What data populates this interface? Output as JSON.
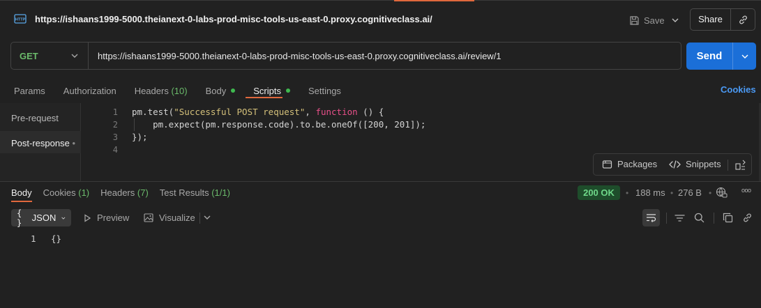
{
  "request": {
    "title": "https://ishaans1999-5000.theianext-0-labs-prod-misc-tools-us-east-0.proxy.cognitiveclass.ai/",
    "method": "GET",
    "url": "https://ishaans1999-5000.theianext-0-labs-prod-misc-tools-us-east-0.proxy.cognitiveclass.ai/review/1"
  },
  "toolbar": {
    "save_label": "Save",
    "share_label": "Share",
    "send_label": "Send"
  },
  "request_tabs": {
    "params": "Params",
    "authorization": "Authorization",
    "headers": "Headers",
    "headers_count": "(10)",
    "body": "Body",
    "scripts": "Scripts",
    "settings": "Settings",
    "cookies": "Cookies"
  },
  "scripts_panel": {
    "pre_request": "Pre-request",
    "post_response": "Post-response",
    "post_response_marker": "•",
    "line_numbers": [
      "1",
      "2",
      "3",
      "4"
    ],
    "code": {
      "l1_a": "pm.test(",
      "l1_str": "\"Successful POST request\"",
      "l1_b": ", ",
      "l1_kw": "function",
      "l1_c": " () {",
      "l2": "    pm.expect(pm.response.code).to.be.oneOf([200, 201]);",
      "l3": "});"
    },
    "packages_label": "Packages",
    "snippets_label": "Snippets"
  },
  "response": {
    "tabs": {
      "body": "Body",
      "cookies": "Cookies",
      "cookies_count": "(1)",
      "headers": "Headers",
      "headers_count": "(7)",
      "tests": "Test Results",
      "tests_count": "(1/1)"
    },
    "status": "200 OK",
    "time": "188 ms",
    "size": "276 B",
    "separator": "•",
    "more": "ooo",
    "format": "JSON",
    "format_prefix": "{ }",
    "preview_label": "Preview",
    "visualize_label": "Visualize",
    "body_line_number": "1",
    "body_text": "{}"
  },
  "colors": {
    "accent": "#e0683d",
    "send": "#1b6fd8",
    "method_get": "#6bbb6b",
    "status_ok": "#6fd98a",
    "link": "#4b9af5"
  }
}
